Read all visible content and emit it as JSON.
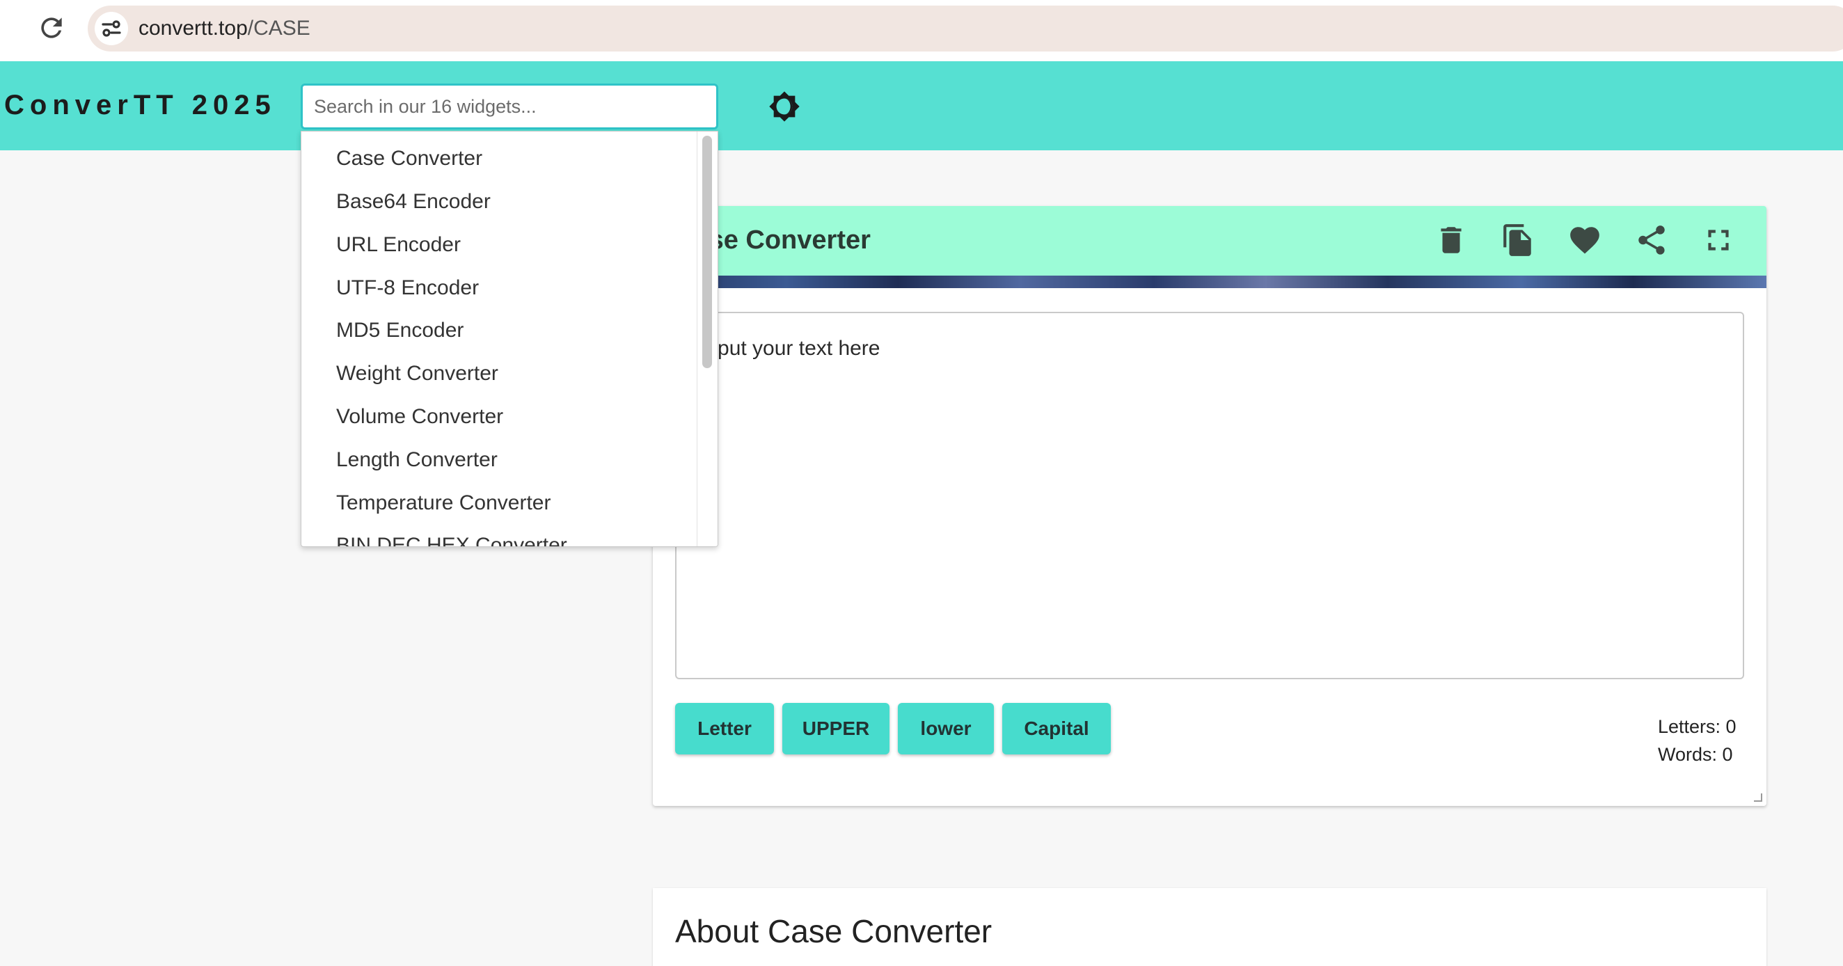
{
  "browser": {
    "url_domain": "convertt.top",
    "url_path": "/CASE"
  },
  "header": {
    "logo": "ConverTT 2025",
    "search_placeholder": "Search in our 16 widgets..."
  },
  "dropdown": {
    "items": [
      "Case Converter",
      "Base64 Encoder",
      "URL Encoder",
      "UTF-8 Encoder",
      "MD5 Encoder",
      "Weight Converter",
      "Volume Converter",
      "Length Converter",
      "Temperature Converter",
      "BIN DEC HEX Converter"
    ]
  },
  "widget": {
    "title": "Case Converter",
    "controls": [
      "trash-icon",
      "copy-icon",
      "heart-icon",
      "share-icon",
      "fullscreen-icon"
    ],
    "textarea_placeholder": "Input your text here",
    "buttons": {
      "letter": "Letter",
      "upper": "UPPER",
      "lower": "lower",
      "capital": "Capital"
    },
    "stats": {
      "letters": "Letters: 0",
      "words": "Words: 0"
    }
  },
  "about": {
    "title": "About Case Converter"
  },
  "colors": {
    "header_bg": "#56e0d2",
    "card_header_bg": "#9cfcd7",
    "button_bg": "#47dccd",
    "search_border": "#2fc3c7"
  }
}
